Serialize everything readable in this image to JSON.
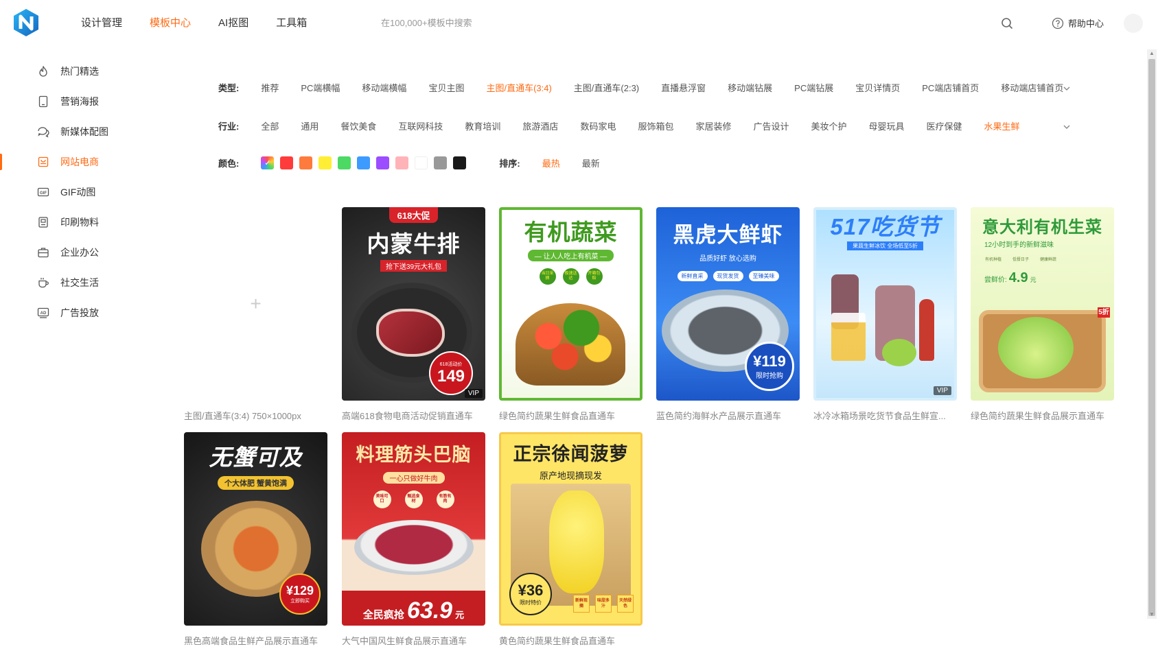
{
  "header": {
    "nav": [
      "设计管理",
      "模板中心",
      "AI抠图",
      "工具箱"
    ],
    "active_nav": "模板中心",
    "search_placeholder": "在100,000+模板中搜索",
    "help_label": "帮助中心"
  },
  "sidebar": {
    "items": [
      {
        "label": "热门精选",
        "icon": "flame-icon"
      },
      {
        "label": "营销海报",
        "icon": "poster-icon"
      },
      {
        "label": "新媒体配图",
        "icon": "chat-icon"
      },
      {
        "label": "网站电商",
        "icon": "shop-icon"
      },
      {
        "label": "GIF动图",
        "icon": "gif-icon"
      },
      {
        "label": "印刷物料",
        "icon": "print-icon"
      },
      {
        "label": "企业办公",
        "icon": "briefcase-icon"
      },
      {
        "label": "社交生活",
        "icon": "cup-icon"
      },
      {
        "label": "广告投放",
        "icon": "ad-icon"
      }
    ],
    "active": "网站电商"
  },
  "filters": {
    "type_label": "类型:",
    "types": [
      "推荐",
      "PC端横幅",
      "移动端横幅",
      "宝贝主图",
      "主图/直通车(3:4)",
      "主图/直通车(2:3)",
      "直播悬浮窗",
      "移动端钻展",
      "PC端钻展",
      "宝贝详情页",
      "PC端店铺首页",
      "移动端店铺首页"
    ],
    "active_type": "主图/直通车(3:4)",
    "industry_label": "行业:",
    "industries": [
      "全部",
      "通用",
      "餐饮美食",
      "互联网科技",
      "教育培训",
      "旅游酒店",
      "数码家电",
      "服饰箱包",
      "家居装修",
      "广告设计",
      "美妆个护",
      "母婴玩具",
      "医疗保健",
      "水果生鲜"
    ],
    "active_industry": "水果生鲜",
    "color_label": "颜色:",
    "colors": [
      "#ff3b3b",
      "#ff7a3d",
      "#ffee33",
      "#4cd964",
      "#3d9bff",
      "#9b4dff",
      "#ffb3b8",
      "#ffffff",
      "#999999",
      "#1a1a1a"
    ],
    "sort_label": "排序:",
    "sorts": [
      "最热",
      "最新"
    ],
    "active_sort": "最热"
  },
  "upload_caption": "主图/直通车(3:4) 750×1000px",
  "templates": [
    {
      "caption": "高端618食物电商活动促销直通车",
      "title": "内蒙牛排",
      "tag": "618大促",
      "sub": "抢下送39元大礼包",
      "price": "149",
      "price_note": "618活动价",
      "vip": "VIP"
    },
    {
      "caption": "绿色简约蔬果生鲜食品直通车",
      "title": "有机蔬菜",
      "sub": "— 让人人吃上有机菜 —",
      "chips": [
        "当日采摘",
        "极速送达",
        "开箱包赔"
      ]
    },
    {
      "caption": "蓝色简约海鲜水产品展示直通车",
      "title": "黑虎大鲜虾",
      "sub": "品质好虾 放心选购",
      "chips": [
        "新鲜直采",
        "现货发货",
        "至臻美味"
      ],
      "price": "¥119",
      "price_note": "限时抢购"
    },
    {
      "caption": "冰冷冰箱场景吃货节食品生鲜宣...",
      "title": "517吃货节",
      "sub": "果蔬生鲜冰饮 全场低至5折",
      "vip": "VIP"
    },
    {
      "caption": "绿色简约蔬果生鲜食品展示直通车",
      "title": "意大利有机生菜",
      "sub": "12小时到手的新鲜滋味",
      "price_label": "尝鲜价:",
      "price": "4.9",
      "unit": "元",
      "chips": [
        "有机种植",
        "低餐日子",
        "健康鲜蔬"
      ],
      "discount": "5折"
    },
    {
      "caption": "黑色高端食品生鲜产品展示直通车",
      "title": "无蟹可及",
      "sub": "个大体肥 蟹黄饱满",
      "price": "¥129",
      "price_note": "立即购买"
    },
    {
      "caption": "大气中国风生鲜食品展示直通车",
      "title": "料理筋头巴脑",
      "sub": "一心只做好牛肉",
      "chips": [
        "美味可口",
        "甄选食材",
        "有筋有肉"
      ],
      "promo": "全民疯抢",
      "price": "63.9",
      "unit": "元"
    },
    {
      "caption": "黄色简约蔬果生鲜食品直通车",
      "title": "正宗徐闻菠萝",
      "sub": "原产地现摘现发",
      "price": "¥36",
      "price_note": "限时特价",
      "chips": [
        "新鲜现摘",
        "味甜多汁",
        "天然绿色"
      ]
    }
  ]
}
